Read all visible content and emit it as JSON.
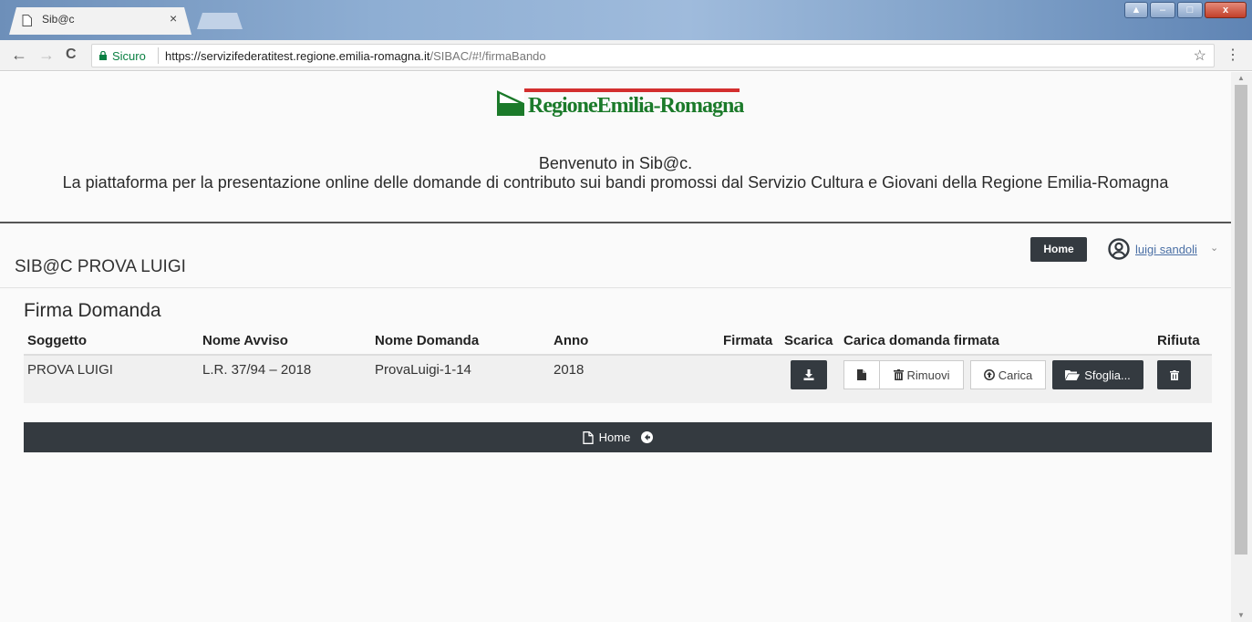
{
  "browser": {
    "tab_title": "Sib@c",
    "tab_close": "×",
    "secure_label": "Sicuro",
    "url_host": "https://servizifederatitest.regione.emilia-romagna.it",
    "url_path": "/SIBAC/#!/firmaBando",
    "nav": {
      "back": "←",
      "forward": "→",
      "reload": "C"
    },
    "star": "☆",
    "menu": "⋮",
    "window_buttons": {
      "minimize": "–",
      "maximize": "□",
      "close": "x"
    }
  },
  "header": {
    "logo_text": "RegioneEmilia-Romagna",
    "welcome_line1": "Benvenuto in Sib@c.",
    "welcome_line2": "La piattaforma per la presentazione online delle domande di contributo sui bandi promossi dal Servizio Cultura e Giovani della Regione Emilia-Romagna"
  },
  "appbar": {
    "app_title": "SIB@C PROVA LUIGI",
    "home_label": "Home",
    "user_name": "luigi sandoli",
    "user_caret": "⌄"
  },
  "main": {
    "title": "Firma Domanda",
    "columns": {
      "soggetto": "Soggetto",
      "nome_avviso": "Nome Avviso",
      "nome_domanda": "Nome Domanda",
      "anno": "Anno",
      "firmata": "Firmata",
      "scarica": "Scarica",
      "carica": "Carica domanda firmata",
      "rifiuta": "Rifiuta"
    },
    "rows": [
      {
        "soggetto": "PROVA LUIGI",
        "nome_avviso": "L.R. 37/94 – 2018",
        "nome_domanda": "ProvaLuigi-1-14",
        "anno": "2018"
      }
    ],
    "buttons": {
      "rimuovi": "Rimuovi",
      "carica": "Carica",
      "sfoglia": "Sfoglia..."
    },
    "footer_home": "Home"
  },
  "colors": {
    "dark_button": "#343a40",
    "logo_green": "#1b7a2a",
    "logo_red": "#d32f2f",
    "link": "#4a6fa5",
    "secure_green": "#0b8043"
  }
}
